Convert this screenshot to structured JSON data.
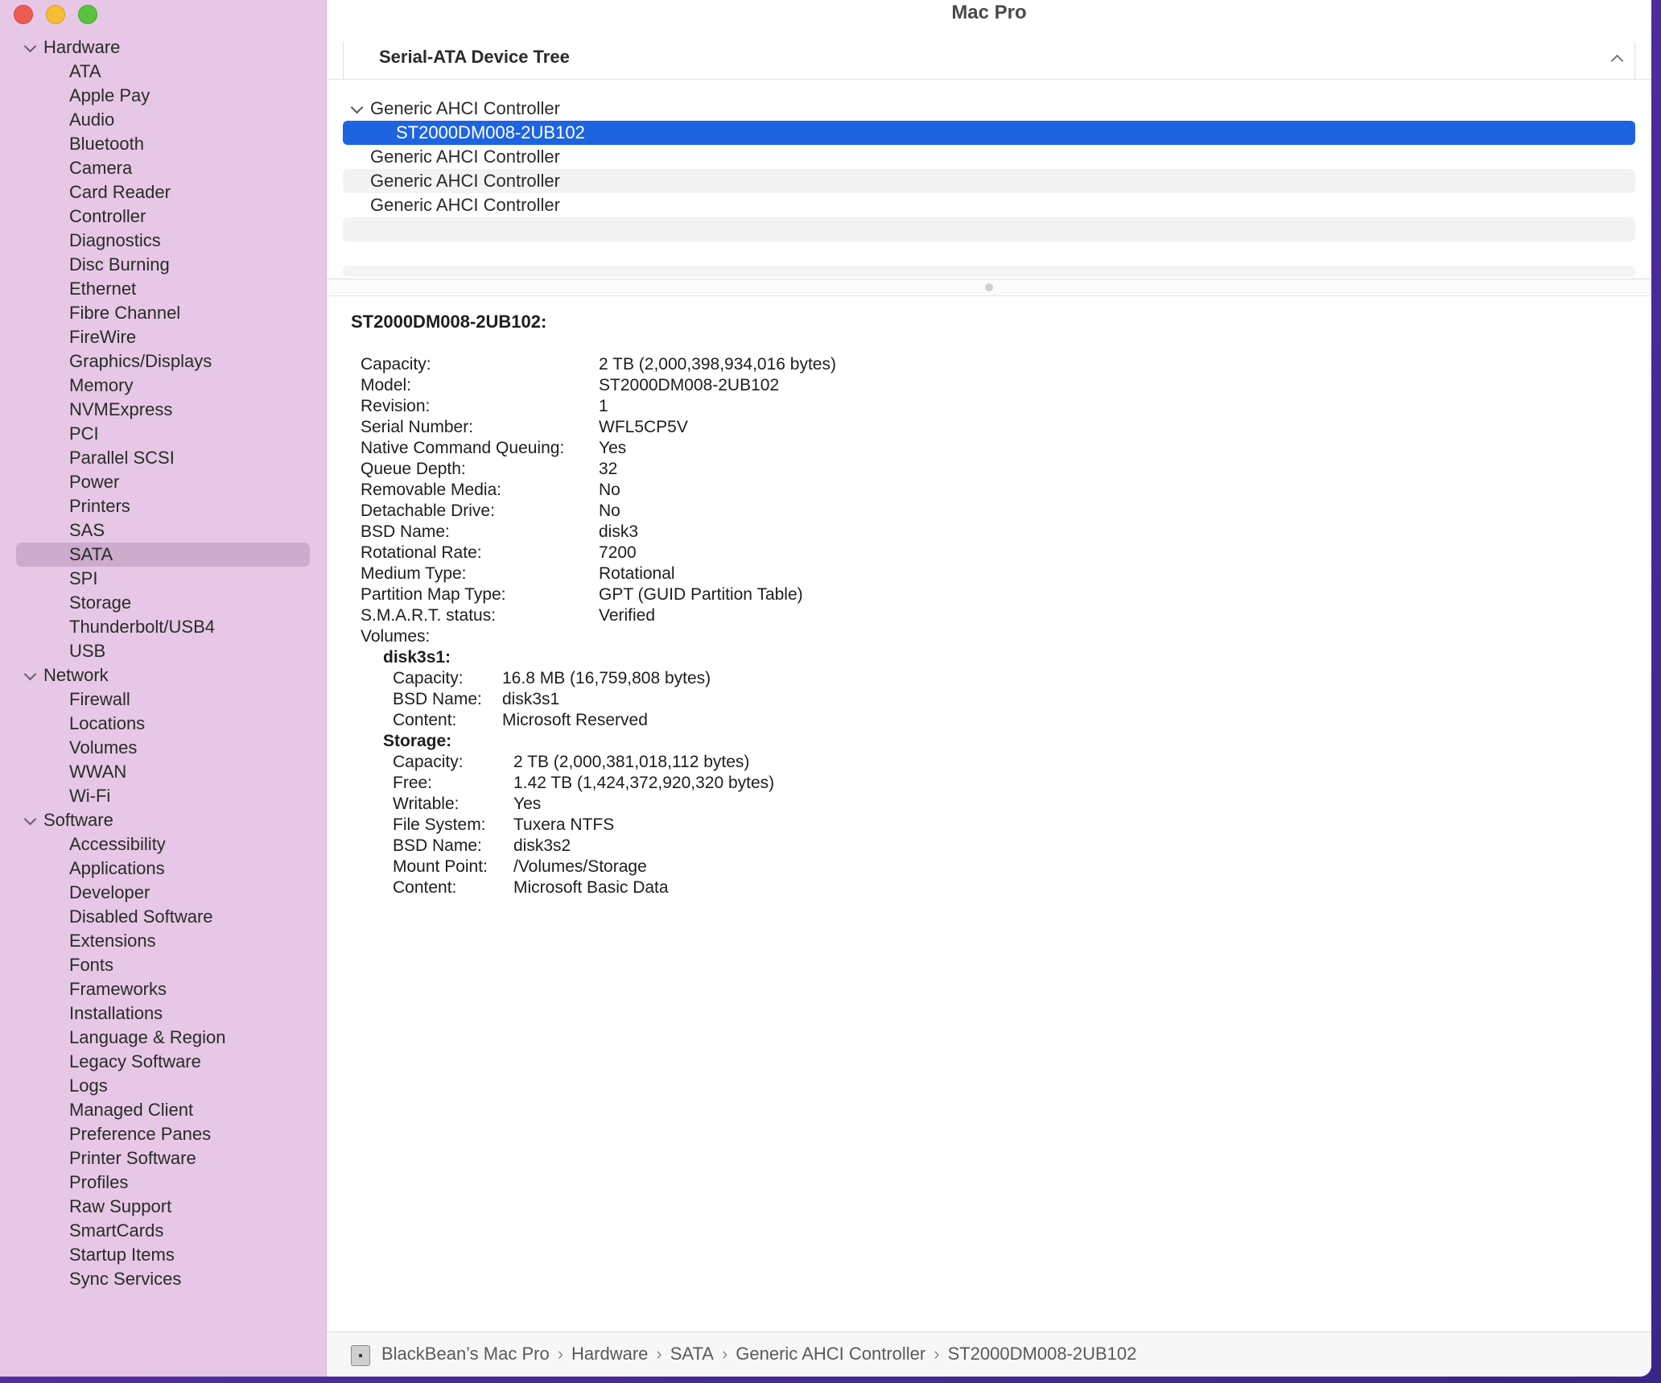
{
  "window": {
    "title": "Mac Pro"
  },
  "sidebar": {
    "sections": [
      {
        "label": "Hardware",
        "items": [
          "ATA",
          "Apple Pay",
          "Audio",
          "Bluetooth",
          "Camera",
          "Card Reader",
          "Controller",
          "Diagnostics",
          "Disc Burning",
          "Ethernet",
          "Fibre Channel",
          "FireWire",
          "Graphics/Displays",
          "Memory",
          "NVMExpress",
          "PCI",
          "Parallel SCSI",
          "Power",
          "Printers",
          "SAS",
          "SATA",
          "SPI",
          "Storage",
          "Thunderbolt/USB4",
          "USB"
        ]
      },
      {
        "label": "Network",
        "items": [
          "Firewall",
          "Locations",
          "Volumes",
          "WWAN",
          "Wi-Fi"
        ]
      },
      {
        "label": "Software",
        "items": [
          "Accessibility",
          "Applications",
          "Developer",
          "Disabled Software",
          "Extensions",
          "Fonts",
          "Frameworks",
          "Installations",
          "Language & Region",
          "Legacy Software",
          "Logs",
          "Managed Client",
          "Preference Panes",
          "Printer Software",
          "Profiles",
          "Raw Support",
          "SmartCards",
          "Startup Items",
          "Sync Services"
        ]
      }
    ],
    "selected": "SATA"
  },
  "tree": {
    "header": "Serial-ATA Device Tree",
    "rows": [
      {
        "label": "Generic AHCI Controller",
        "level": 0,
        "expanded": true
      },
      {
        "label": "ST2000DM008-2UB102",
        "level": 1,
        "selected": true
      },
      {
        "label": "Generic AHCI Controller",
        "level": 0
      },
      {
        "label": "Generic AHCI Controller",
        "level": 0
      },
      {
        "label": "Generic AHCI Controller",
        "level": 0
      }
    ]
  },
  "detail": {
    "title": "ST2000DM008-2UB102:",
    "properties": [
      {
        "key": "Capacity:",
        "value": "2 TB (2,000,398,934,016 bytes)"
      },
      {
        "key": "Model:",
        "value": "ST2000DM008-2UB102"
      },
      {
        "key": "Revision:",
        "value": "1"
      },
      {
        "key": "Serial Number:",
        "value": "WFL5CP5V"
      },
      {
        "key": "Native Command Queuing:",
        "value": "Yes"
      },
      {
        "key": "Queue Depth:",
        "value": "32"
      },
      {
        "key": "Removable Media:",
        "value": "No"
      },
      {
        "key": "Detachable Drive:",
        "value": "No"
      },
      {
        "key": "BSD Name:",
        "value": "disk3"
      },
      {
        "key": "Rotational Rate:",
        "value": "7200"
      },
      {
        "key": "Medium Type:",
        "value": "Rotational"
      },
      {
        "key": "Partition Map Type:",
        "value": "GPT (GUID Partition Table)"
      },
      {
        "key": "S.M.A.R.T. status:",
        "value": "Verified"
      },
      {
        "key": "Volumes:",
        "value": ""
      }
    ],
    "volumes": [
      {
        "name": "disk3s1:",
        "props": [
          {
            "key": "Capacity:",
            "value": "16.8 MB (16,759,808 bytes)"
          },
          {
            "key": "BSD Name:",
            "value": "disk3s1"
          },
          {
            "key": "Content:",
            "value": "Microsoft Reserved"
          }
        ]
      },
      {
        "name": "Storage:",
        "props": [
          {
            "key": "Capacity:",
            "value": "2 TB (2,000,381,018,112 bytes)"
          },
          {
            "key": "Free:",
            "value": "1.42 TB (1,424,372,920,320 bytes)"
          },
          {
            "key": "Writable:",
            "value": "Yes"
          },
          {
            "key": "File System:",
            "value": "Tuxera NTFS"
          },
          {
            "key": "BSD Name:",
            "value": "disk3s2"
          },
          {
            "key": "Mount Point:",
            "value": "/Volumes/Storage"
          },
          {
            "key": "Content:",
            "value": "Microsoft Basic Data"
          }
        ]
      }
    ]
  },
  "statusbar": {
    "icon": "mac-pro-icon",
    "breadcrumb": [
      "BlackBean’s Mac Pro",
      "Hardware",
      "SATA",
      "Generic AHCI Controller",
      "ST2000DM008-2UB102"
    ],
    "separator": "›"
  }
}
